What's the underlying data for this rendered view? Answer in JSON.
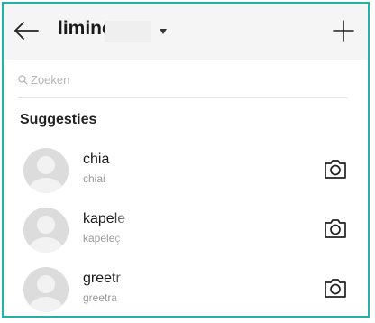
{
  "header": {
    "back_icon": "arrow-left-icon",
    "account_name": "limino",
    "dropdown_icon": "caret-down-icon",
    "add_icon": "plus-icon"
  },
  "search": {
    "placeholder": "Zoeken",
    "icon": "search-icon"
  },
  "suggestions": {
    "title": "Suggesties",
    "items": [
      {
        "username": "chia",
        "subtitle": "chiai",
        "action_icon": "camera-icon"
      },
      {
        "username": "kapele",
        "subtitle": "kapeleç",
        "action_icon": "camera-icon"
      },
      {
        "username": "greetr",
        "subtitle": "greetra",
        "action_icon": "camera-icon"
      }
    ]
  },
  "colors": {
    "frame_border": "#22b3a6",
    "header_bg": "#f5f5f5",
    "avatar_bg": "#dcdcdc"
  }
}
